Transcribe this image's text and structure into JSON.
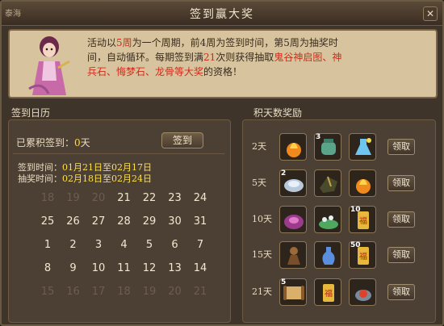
{
  "window": {
    "title": "签到赢大奖",
    "topleft_text": "泰海",
    "close_label": "✕"
  },
  "banner": {
    "segments": [
      {
        "text": "活动以",
        "hl": false
      },
      {
        "text": "5周",
        "hl": true
      },
      {
        "text": "为一个周期，前4周为签到时间，第5周为抽奖时间，自动循环。每期签到满",
        "hl": false
      },
      {
        "text": "21",
        "hl": true
      },
      {
        "text": "次则获得抽取",
        "hl": false
      },
      {
        "text": "鬼谷神启图、神兵石、悔梦石、龙骨等大奖",
        "hl": true
      },
      {
        "text": "的资格！",
        "hl": false
      }
    ]
  },
  "left": {
    "section_title": "签到日历",
    "counter_label": "已累积签到：",
    "counter_value": "0",
    "counter_unit": "天",
    "signin_label": "签到",
    "signin_time_label": "签到时间：",
    "signin_start": "01月21日",
    "signin_to": "至",
    "signin_end": "02月17日",
    "draw_time_label": "抽奖时间：",
    "draw_start": "02月18日",
    "draw_to": "至",
    "draw_end": "02月24日",
    "calendar": [
      [
        "18",
        "19",
        "20",
        "21",
        "22",
        "23",
        "24"
      ],
      [
        "25",
        "26",
        "27",
        "28",
        "29",
        "30",
        "31"
      ],
      [
        "1",
        "2",
        "3",
        "4",
        "5",
        "6",
        "7"
      ],
      [
        "8",
        "9",
        "10",
        "11",
        "12",
        "13",
        "14"
      ],
      [
        "15",
        "16",
        "17",
        "18",
        "19",
        "20",
        "21"
      ]
    ]
  },
  "right": {
    "section_title": "积天数奖励",
    "claim_label": "领取",
    "rows": [
      {
        "days": "2天",
        "items": [
          {
            "icon": "fire-orb-icon",
            "qty": ""
          },
          {
            "icon": "jade-cauldron-icon",
            "qty": "3"
          },
          {
            "icon": "crystal-flask-icon",
            "qty": ""
          }
        ]
      },
      {
        "days": "5天",
        "items": [
          {
            "icon": "silver-shell-icon",
            "qty": "2"
          },
          {
            "icon": "dark-ore-icon",
            "qty": ""
          },
          {
            "icon": "fire-orb-icon",
            "qty": ""
          }
        ]
      },
      {
        "days": "10天",
        "items": [
          {
            "icon": "purple-silk-icon",
            "qty": ""
          },
          {
            "icon": "lotus-icon",
            "qty": ""
          },
          {
            "icon": "gold-talisman-icon",
            "qty": "10"
          }
        ]
      },
      {
        "days": "15天",
        "items": [
          {
            "icon": "bronze-figure-icon",
            "qty": ""
          },
          {
            "icon": "blue-vase-icon",
            "qty": ""
          },
          {
            "icon": "gold-talisman-icon",
            "qty": "50"
          }
        ]
      },
      {
        "days": "21天",
        "items": [
          {
            "icon": "scroll-icon",
            "qty": "5"
          },
          {
            "icon": "gold-talisman-icon",
            "qty": ""
          },
          {
            "icon": "red-gem-icon",
            "qty": ""
          }
        ]
      }
    ]
  }
}
